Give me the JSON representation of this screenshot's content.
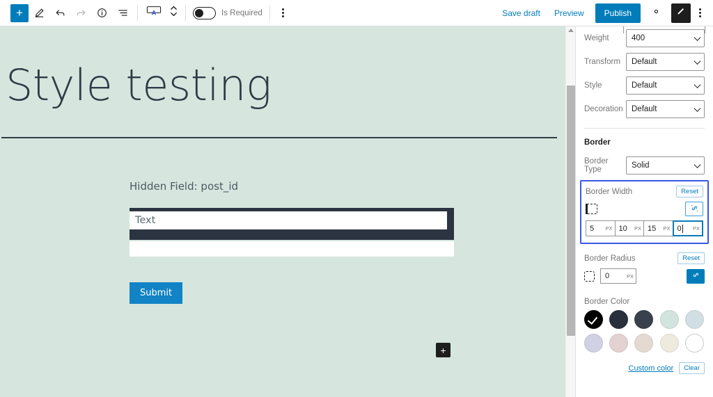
{
  "toolbar": {
    "inserter_label": "+",
    "tools": [
      {
        "name": "edit-tool-icon",
        "glyph": "pencil"
      },
      {
        "name": "undo-icon",
        "glyph": "undo"
      },
      {
        "name": "redo-icon",
        "glyph": "redo"
      },
      {
        "name": "details-info-icon",
        "glyph": "info"
      },
      {
        "name": "list-view-icon",
        "glyph": "list"
      }
    ],
    "block_type_icon": "input-field-block-icon",
    "movers_icon": "move-up-down-icon",
    "toggle": {
      "label": "Is Required",
      "state": "off"
    },
    "options_icon": "more-options-icon",
    "save_draft_label": "Save draft",
    "preview_label": "Preview",
    "publish_label": "Publish",
    "settings_icon": "gear-icon",
    "styles_icon": "paintbrush-icon",
    "more_icon": "more-menu-icon"
  },
  "canvas": {
    "post_title": "Style testing",
    "hidden_field_label": "Hidden Field: post_id",
    "text_input_value": "Text",
    "submit_label": "Submit",
    "appender_label": "+",
    "background_color": "#d6e6de",
    "applied_border": {
      "top": "5",
      "right": "10",
      "bottom": "15",
      "left": "0",
      "color": "#2b3440",
      "unit": "px"
    }
  },
  "sidebar": {
    "typography_fields": [
      {
        "label": "Weight",
        "value": "400"
      },
      {
        "label": "Transform",
        "value": "Default"
      },
      {
        "label": "Style",
        "value": "Default"
      },
      {
        "label": "Decoration",
        "value": "Default"
      }
    ],
    "border_section_title": "Border",
    "border_type": {
      "label": "Border Type",
      "value": "Solid"
    },
    "border_width": {
      "title": "Border Width",
      "reset_label": "Reset",
      "link_icon": "unlink-sides-icon",
      "side_icon": "border-side-left-icon",
      "inputs": [
        {
          "name": "border-width-top",
          "value": "5",
          "unit": "PX",
          "focused": false
        },
        {
          "name": "border-width-right",
          "value": "10",
          "unit": "PX",
          "focused": false
        },
        {
          "name": "border-width-bottom",
          "value": "15",
          "unit": "PX",
          "focused": false
        },
        {
          "name": "border-width-left",
          "value": "0",
          "unit": "PX",
          "focused": true
        }
      ],
      "focus_outline_color": "#3858e9"
    },
    "border_radius": {
      "title": "Border Radius",
      "reset_label": "Reset",
      "value": "0",
      "unit": "PX",
      "link_icon": "link-corners-icon"
    },
    "border_color": {
      "title": "Border Color",
      "swatches": [
        {
          "name": "swatch-black",
          "hex": "#000000",
          "selected": true
        },
        {
          "name": "swatch-dark-navy",
          "hex": "#28303d",
          "selected": false
        },
        {
          "name": "swatch-slate",
          "hex": "#39414d",
          "selected": false
        },
        {
          "name": "swatch-pale-green",
          "hex": "#d1e4dd",
          "selected": false
        },
        {
          "name": "swatch-pale-blue",
          "hex": "#d1dfe4",
          "selected": false
        },
        {
          "name": "swatch-lavender",
          "hex": "#d1d1e4",
          "selected": false
        },
        {
          "name": "swatch-pale-pink",
          "hex": "#e4d1d1",
          "selected": false
        },
        {
          "name": "swatch-beige",
          "hex": "#e4dad1",
          "selected": false
        },
        {
          "name": "swatch-cream",
          "hex": "#eeeadd",
          "selected": false
        },
        {
          "name": "swatch-white",
          "hex": "#ffffff",
          "selected": false
        }
      ],
      "custom_color_label": "Custom color",
      "clear_label": "Clear"
    }
  }
}
